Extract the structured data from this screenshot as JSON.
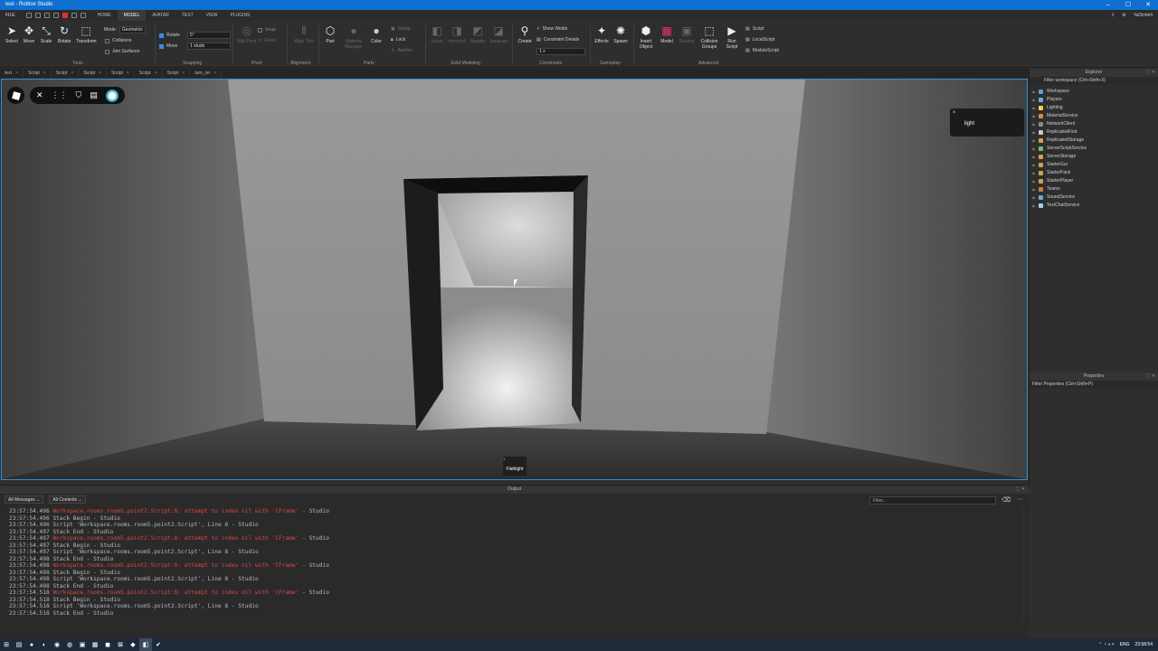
{
  "window": {
    "title": "test - Roblox Studio",
    "minimize": "–",
    "maximize": "☐",
    "close": "✕"
  },
  "menubar": {
    "file": "FILE",
    "tabs": [
      "HOME",
      "MODEL",
      "AVATAR",
      "TEST",
      "VIEW",
      "PLUGINS"
    ],
    "active": "MODEL",
    "user": "YaDimbi4"
  },
  "ribbon": {
    "tools": {
      "select": "Select",
      "move": "Move",
      "scale": "Scale",
      "rotate": "Rotate",
      "transform": "Transform",
      "group_label": "Tools"
    },
    "mode": {
      "label": "Mode:",
      "value": "Geometric"
    },
    "collisions": "Collisions",
    "join_surfaces": "Join Surfaces",
    "snapping": {
      "rotate_label": "Rotate",
      "rotate_value": "5°",
      "move_label": "Move",
      "move_value": "1 studs",
      "group_label": "Snapping"
    },
    "pivot": {
      "edit_pivot": "Edit Pivot",
      "snap": "Snap",
      "reset": "Reset",
      "group_label": "Pivot"
    },
    "alignment": {
      "align_tool": "Align Tool",
      "group_label": "Alignment"
    },
    "parts": {
      "part": "Part",
      "material_manager": "Material Manager",
      "color": "Color",
      "group": "Group",
      "lock": "Lock",
      "anchor": "Anchor",
      "group_label": "Parts"
    },
    "solid": {
      "union": "Union",
      "intersect": "Intersect",
      "negate": "Negate",
      "separate": "Separate",
      "group_label": "Solid Modeling"
    },
    "constraints": {
      "create": "Create",
      "show_welds": "Show Welds",
      "constraint_details": "Constraint Details",
      "scale_value": "1 x",
      "group_label": "Constraints"
    },
    "gameplay": {
      "effects": "Effects",
      "spawn": "Spawn",
      "group_label": "Gameplay"
    },
    "advanced": {
      "insert_object": "Insert Object",
      "model": "Model",
      "service": "Service",
      "collision_groups": "Collision Groups",
      "run_script": "Run Script",
      "script": "Script",
      "local_script": "LocalScript",
      "module_script": "ModuleScript",
      "group_label": "Advanced"
    }
  },
  "tabs": [
    "test",
    "Script",
    "Script",
    "Script",
    "Script",
    "Script",
    "Script",
    "turn_on"
  ],
  "viewport": {
    "light_label": "light",
    "light_close": "×",
    "flash_num": "1",
    "flash_name": "Flahlight"
  },
  "explorer": {
    "title": "Explorer",
    "filter": "Filter workspace (Ctrl+Shift+X)",
    "items": [
      {
        "name": "Workspace",
        "color": "#4da3e0"
      },
      {
        "name": "Players",
        "color": "#6aa9d8"
      },
      {
        "name": "Lighting",
        "color": "#f2d24b"
      },
      {
        "name": "MaterialService",
        "color": "#d98b3a"
      },
      {
        "name": "NetworkClient",
        "color": "#8a8a8a"
      },
      {
        "name": "ReplicatedFirst",
        "color": "#c9c9c9"
      },
      {
        "name": "ReplicatedStorage",
        "color": "#d2a24c"
      },
      {
        "name": "ServerScriptService",
        "color": "#6ec16a"
      },
      {
        "name": "ServerStorage",
        "color": "#d2a24c"
      },
      {
        "name": "StarterGui",
        "color": "#d2a24c"
      },
      {
        "name": "StarterPack",
        "color": "#d2a24c"
      },
      {
        "name": "StarterPlayer",
        "color": "#d2a24c"
      },
      {
        "name": "Teams",
        "color": "#d27a3a"
      },
      {
        "name": "SoundService",
        "color": "#6aa9d8"
      },
      {
        "name": "TextChatService",
        "color": "#9fd0f0"
      }
    ]
  },
  "properties": {
    "title": "Properties",
    "filter": "Filter Properties (Ctrl+Shift+P)"
  },
  "output": {
    "title": "Output",
    "messages_filter": "All Messages",
    "contexts_filter": "All Contexts",
    "filter_placeholder": "Filter...",
    "lines": [
      {
        "ts": "23:57:54.496",
        "msg": "Workspace.rooms.room5.point2.Script:8: attempt to index nil with 'CFrame'",
        "src": "  -  Studio",
        "err": true
      },
      {
        "ts": "23:57:54.496",
        "msg": "Stack Begin",
        "src": "  -  Studio",
        "err": false
      },
      {
        "ts": "23:57:54.496",
        "msg": "Script 'Workspace.rooms.room5.point2.Script', Line 8",
        "src": "  -  Studio",
        "err": false
      },
      {
        "ts": "23:57:54.497",
        "msg": "Stack End",
        "src": "  -  Studio",
        "err": false
      },
      {
        "ts": "23:57:54.497",
        "msg": "Workspace.rooms.room5.point2.Script:8: attempt to index nil with 'CFrame'",
        "src": "  -  Studio",
        "err": true
      },
      {
        "ts": "23:57:54.497",
        "msg": "Stack Begin",
        "src": "  -  Studio",
        "err": false
      },
      {
        "ts": "23:57:54.497",
        "msg": "Script 'Workspace.rooms.room5.point2.Script', Line 8",
        "src": "  -  Studio",
        "err": false
      },
      {
        "ts": "23:57:54.498",
        "msg": "Stack End",
        "src": "  -  Studio",
        "err": false
      },
      {
        "ts": "23:57:54.498",
        "msg": "Workspace.rooms.room5.point2.Script:8: attempt to index nil with 'CFrame'",
        "src": "  -  Studio",
        "err": true
      },
      {
        "ts": "23:57:54.498",
        "msg": "Stack Begin",
        "src": "  -  Studio",
        "err": false
      },
      {
        "ts": "23:57:54.498",
        "msg": "Script 'Workspace.rooms.room5.point2.Script', Line 8",
        "src": "  -  Studio",
        "err": false
      },
      {
        "ts": "23:57:54.498",
        "msg": "Stack End",
        "src": "  -  Studio",
        "err": false
      },
      {
        "ts": "23:57:54.518",
        "msg": "Workspace.rooms.room5.point2.Script:8: attempt to index nil with 'CFrame'",
        "src": "  -  Studio",
        "err": true
      },
      {
        "ts": "23:57:54.518",
        "msg": "Stack Begin",
        "src": "  -  Studio",
        "err": false
      },
      {
        "ts": "23:57:54.518",
        "msg": "Script 'Workspace.rooms.room5.point2.Script', Line 8",
        "src": "  -  Studio",
        "err": false
      },
      {
        "ts": "23:57:54.518",
        "msg": "Stack End",
        "src": "  -  Studio",
        "err": false
      }
    ]
  },
  "taskbar": {
    "lang": "ENG",
    "time": "23:58:54"
  }
}
